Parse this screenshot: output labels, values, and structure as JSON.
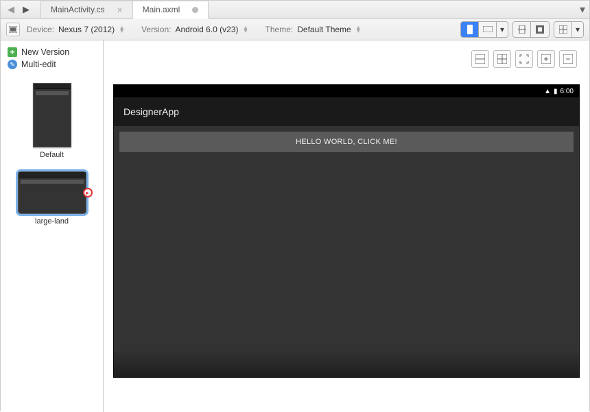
{
  "tabs": {
    "t1": "MainActivity.cs",
    "t2": "Main.axml"
  },
  "toolbar": {
    "deviceLabel": "Device:",
    "deviceValue": "Nexus 7 (2012)",
    "versionLabel": "Version:",
    "versionValue": "Android 6.0 (v23)",
    "themeLabel": "Theme:",
    "themeValue": "Default Theme"
  },
  "sidebar": {
    "newVersion": "New Version",
    "multiEdit": "Multi-edit",
    "thumb1": "Default",
    "thumb2": "large-land"
  },
  "device": {
    "time": "6:00",
    "appTitle": "DesignerApp",
    "button": "HELLO WORLD, CLICK ME!"
  }
}
